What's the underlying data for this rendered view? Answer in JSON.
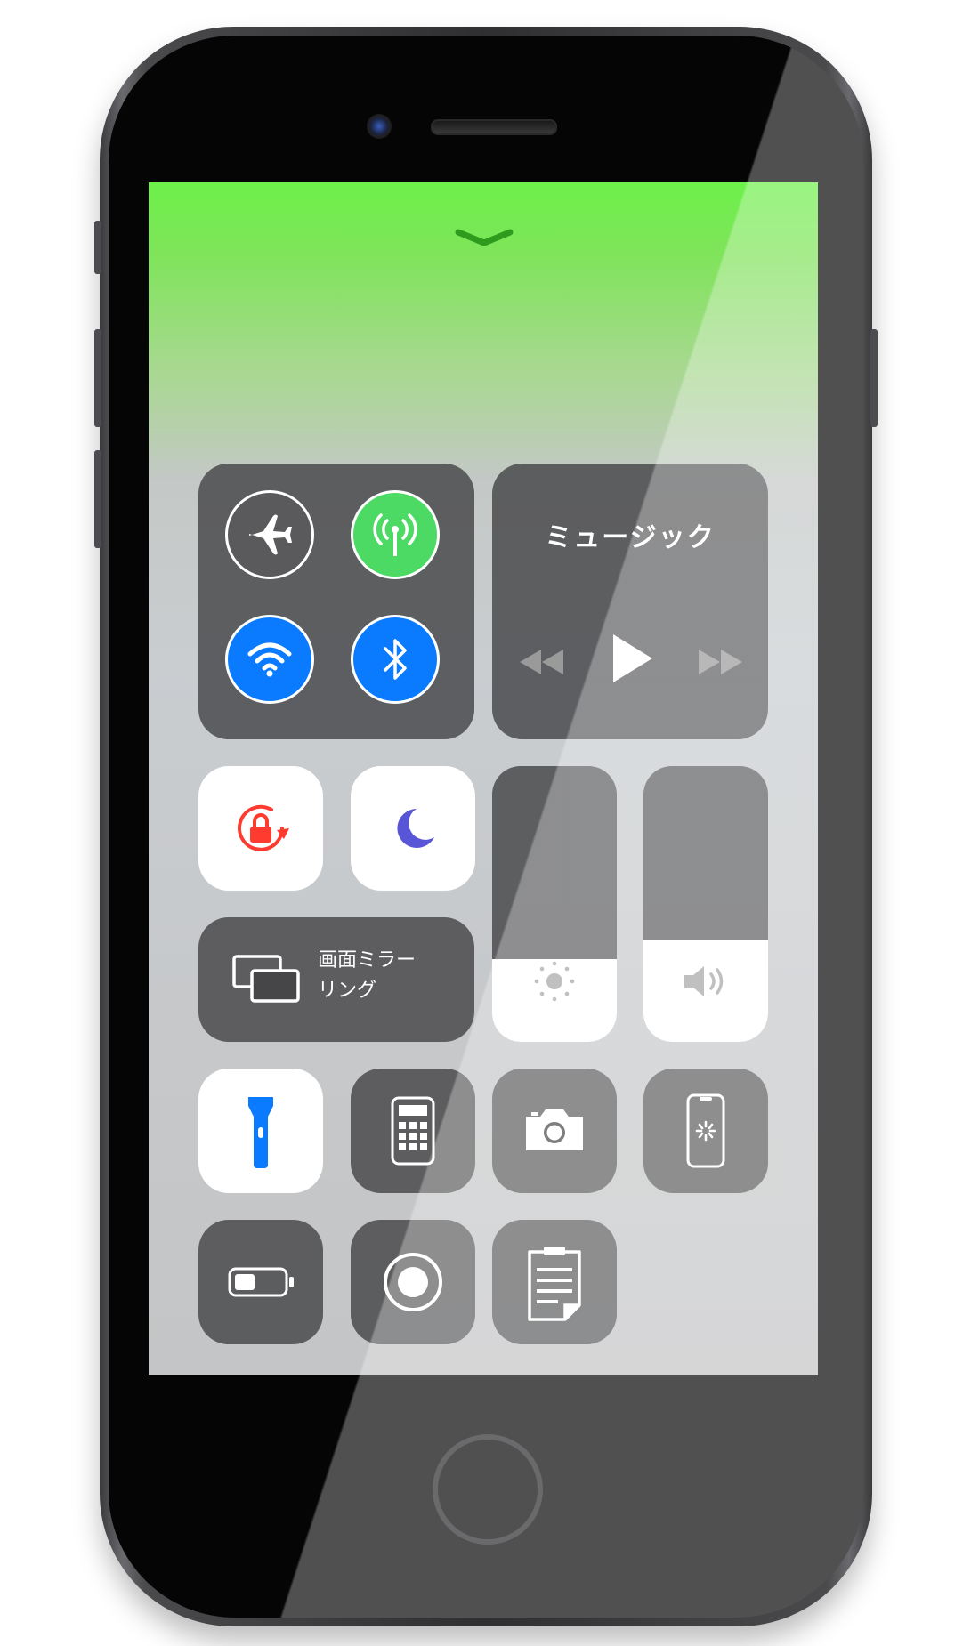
{
  "control_center": {
    "music": {
      "title": "ミュージック"
    },
    "screen_mirroring": {
      "label_line1": "画面ミラー",
      "label_line2": "リング"
    },
    "brightness_level": 0.3,
    "volume_level": 0.37
  },
  "icons": {
    "airplane_mode": "airplane-icon",
    "cellular_data": "cellular-antenna-icon",
    "wifi": "wifi-icon",
    "bluetooth": "bluetooth-icon",
    "rotation_lock": "rotation-lock-icon",
    "do_not_disturb": "moon-icon",
    "flashlight": "flashlight-icon",
    "calculator": "calculator-icon",
    "camera": "camera-icon",
    "screen_recording_phone": "phone-loading-icon",
    "low_power": "battery-icon",
    "screen_record": "record-icon",
    "notes": "notes-icon"
  },
  "colors": {
    "green_active": "#4cd964",
    "blue_active": "#0a7bff",
    "rotation_red": "#ff3b30",
    "moon_purple": "#5856d6",
    "flashlight_blue": "#0a7bff"
  }
}
